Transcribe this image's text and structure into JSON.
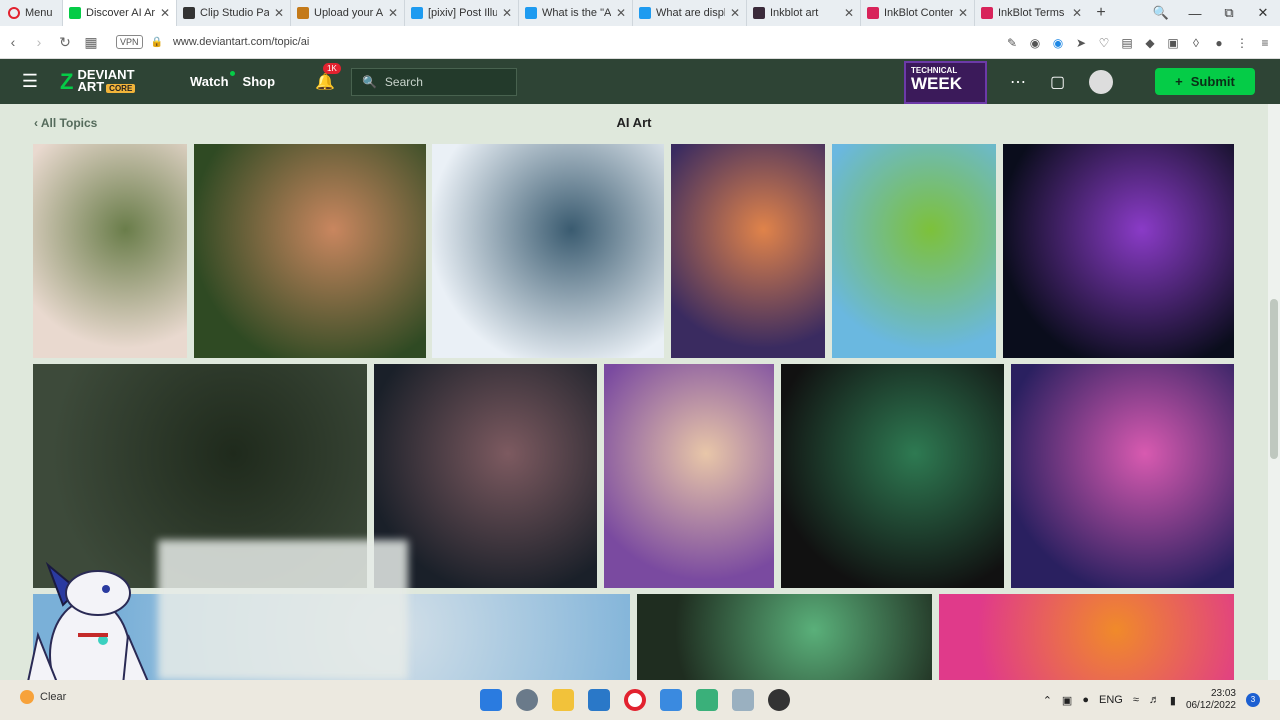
{
  "browser": {
    "menu_label": "Menu",
    "tabs": [
      {
        "label": "Discover AI Art",
        "color": "#05cc47",
        "active": true
      },
      {
        "label": "Clip Studio Paint",
        "color": "#333333"
      },
      {
        "label": "Upload your Ar",
        "color": "#c47a1a"
      },
      {
        "label": "[pixiv] Post Illus",
        "color": "#1e9bf0"
      },
      {
        "label": "What is the \"AI",
        "color": "#1e9bf0"
      },
      {
        "label": "What are displa",
        "color": "#1e9bf0"
      },
      {
        "label": "Inkblot art",
        "color": "#3a2a3a"
      },
      {
        "label": "InkBlot Content",
        "color": "#d8235a"
      },
      {
        "label": "InkBlot Terms o",
        "color": "#d8235a"
      }
    ],
    "vpn_label": "VPN",
    "url": "www.deviantart.com/topic/ai"
  },
  "header": {
    "logo_line1": "DEVIANT",
    "logo_line2": "ART",
    "core_label": "CORE",
    "watch_label": "Watch",
    "shop_label": "Shop",
    "notification_count": "1K",
    "search_placeholder": "Search",
    "promo_top": "TECHNICAL",
    "promo_big": "WEEK",
    "submit_label": "Submit"
  },
  "page": {
    "back_label": "All Topics",
    "title": "AI Art"
  },
  "gallery": [
    {
      "name": "sheep-girl-art",
      "colors": [
        "#e9d9cf",
        "#6a7d4a"
      ]
    },
    {
      "name": "smiling-girl-art",
      "colors": [
        "#2f4a23",
        "#c9865f"
      ]
    },
    {
      "name": "snowy-mountains-art",
      "colors": [
        "#eaf0f6",
        "#3a5b70"
      ]
    },
    {
      "name": "hooded-woman-art",
      "colors": [
        "#3a2b60",
        "#e0834a"
      ]
    },
    {
      "name": "cottage-meadow-art",
      "colors": [
        "#6ab8e0",
        "#7dc13a"
      ]
    },
    {
      "name": "dragon-art",
      "colors": [
        "#0a0d1c",
        "#8a3bc7"
      ]
    },
    {
      "name": "forest-spirit-art",
      "colors": [
        "#3d4a3a",
        "#1f2a1c"
      ]
    },
    {
      "name": "feathered-woman-art",
      "colors": [
        "#1a2029",
        "#7d5a60"
      ]
    },
    {
      "name": "witch-art",
      "colors": [
        "#7a4aa0",
        "#e8c6a8"
      ]
    },
    {
      "name": "ring-art",
      "colors": [
        "#111111",
        "#2e7a52"
      ]
    },
    {
      "name": "astronaut-art",
      "colors": [
        "#2a2060",
        "#d85ab0"
      ]
    },
    {
      "name": "floating-island-art",
      "colors": [
        "#7ab0d8",
        "#d4e0e8"
      ]
    },
    {
      "name": "green-hair-art",
      "colors": [
        "#1f2d20",
        "#5ab07a"
      ]
    },
    {
      "name": "pink-glitch-art",
      "colors": [
        "#e03a8a",
        "#f08a2a"
      ]
    }
  ],
  "taskbar": {
    "weather_label": "Clear",
    "lang": "ENG",
    "time": "23:03",
    "date": "06/12/2022",
    "notif_count": "3"
  }
}
